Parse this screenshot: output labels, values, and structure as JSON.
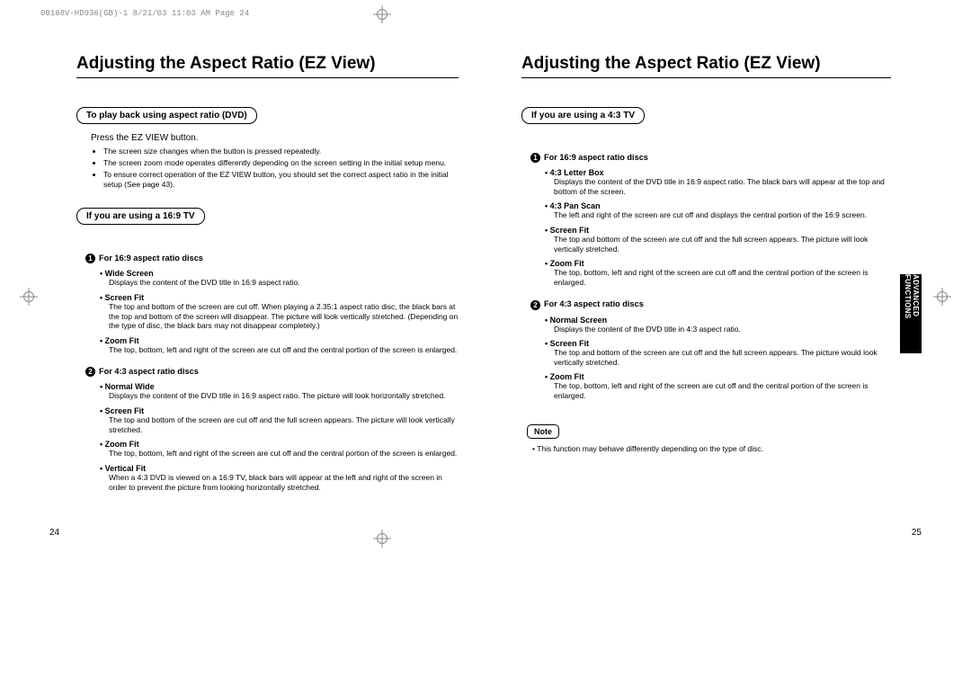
{
  "meta_header": "00168V-HD936(GB)-1  8/21/03 11:03 AM  Page 24",
  "left": {
    "title": "Adjusting the Aspect Ratio (EZ View)",
    "box1": "To play back using aspect ratio (DVD)",
    "instruction": "Press the EZ VIEW button.",
    "notes": [
      "The screen size changes when the button is pressed repeatedly.",
      "The screen zoom mode operates differently depending on the screen setting in the initial setup menu.",
      "To ensure correct operation of the EZ VIEW button, you should set the correct aspect ratio in the initial setup (See page 43)."
    ],
    "box2": "If you are using a 16:9 TV",
    "group1_num": "1",
    "group1_head": "For 16:9 aspect ratio discs",
    "group1": [
      {
        "label": "Wide Screen",
        "desc": "Displays the content of the DVD title in 16:9 aspect ratio."
      },
      {
        "label": "Screen Fit",
        "desc": "The top and bottom of the screen are cut off. When playing a 2.35:1 aspect ratio disc, the black bars at the top and bottom of the screen will disappear. The picture will look vertically stretched. (Depending on the type of disc, the black bars may not disappear completely.)"
      },
      {
        "label": "Zoom Fit",
        "desc": "The top, bottom, left and right of the screen are cut off and the central portion of the screen is enlarged."
      }
    ],
    "group2_num": "2",
    "group2_head": "For 4:3 aspect ratio discs",
    "group2": [
      {
        "label": "Normal Wide",
        "desc": "Displays the content of the DVD title in 16:9 aspect ratio. The picture will look horizontally stretched."
      },
      {
        "label": "Screen Fit",
        "desc": "The top and bottom of the screen are cut off and the full screen appears. The picture will look vertically stretched."
      },
      {
        "label": "Zoom Fit",
        "desc": "The top, bottom, left and right of the screen are cut off and the central portion of the screen is enlarged."
      },
      {
        "label": "Vertical Fit",
        "desc": "When a 4:3 DVD is viewed on a 16:9 TV, black bars will appear at the left and right of the screen in order to prevent the picture from looking horizontally stretched."
      }
    ],
    "pagenum": "24"
  },
  "right": {
    "title": "Adjusting the Aspect Ratio (EZ View)",
    "box1": "If you are using a 4:3 TV",
    "group1_num": "1",
    "group1_head": "For 16:9 aspect ratio discs",
    "group1": [
      {
        "label": "4:3 Letter Box",
        "desc": "Displays the content of the DVD title in 16:9 aspect ratio. The black bars will appear at the top and bottom of the screen."
      },
      {
        "label": "4:3 Pan Scan",
        "desc": "The left and right of the screen are cut off and displays the central portion of the 16:9 screen."
      },
      {
        "label": "Screen Fit",
        "desc": "The top and bottom of the screen are cut off and the full screen appears. The picture will look vertically stretched."
      },
      {
        "label": "Zoom Fit",
        "desc": "The top, bottom, left and right of the screen are cut off and the central portion of the screen is enlarged."
      }
    ],
    "group2_num": "2",
    "group2_head": "For 4:3 aspect ratio discs",
    "group2": [
      {
        "label": "Normal Screen",
        "desc": "Displays the content of the DVD title in 4:3 aspect ratio."
      },
      {
        "label": "Screen Fit",
        "desc": "The top and bottom of the screen are cut off and the full screen appears. The picture would look vertically stretched."
      },
      {
        "label": "Zoom Fit",
        "desc": "The top, bottom, left and right of the screen are cut off and the central portion of the screen is enlarged."
      }
    ],
    "note_label": "Note",
    "note_text": "This function may behave differently depending on the type of disc.",
    "sidetab": "ADVANCED FUNCTIONS",
    "pagenum": "25"
  }
}
